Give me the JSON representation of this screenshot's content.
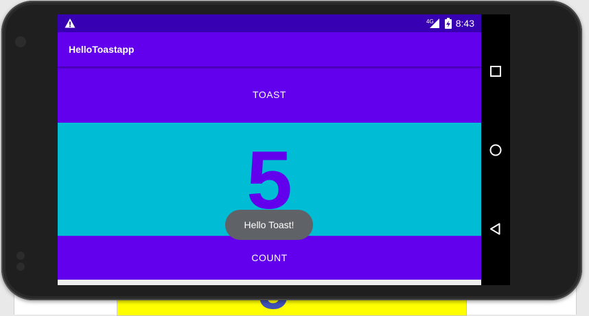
{
  "status_bar": {
    "alert_icon": "warning-icon",
    "network_label": "4G",
    "signal_icon": "signal-icon",
    "battery_icon": "battery-charging-icon",
    "time": "8:43"
  },
  "app_bar": {
    "title": "HelloToastapp"
  },
  "main": {
    "toast_button_label": "TOAST",
    "count_value": "5",
    "count_button_label": "COUNT"
  },
  "toast": {
    "message": "Hello Toast!"
  },
  "nav_bar": {
    "recents_icon": "square-icon",
    "home_icon": "circle-icon",
    "back_icon": "triangle-back-icon"
  },
  "colors": {
    "status_bar": "#3700b3",
    "primary": "#6200ee",
    "count_background": "#00bcd4",
    "toast_background": "#5f6368"
  }
}
